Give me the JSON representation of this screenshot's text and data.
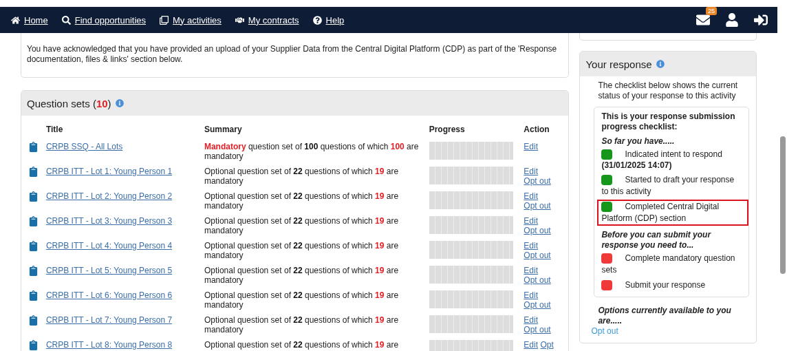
{
  "nav": {
    "items": [
      {
        "kind": "home",
        "label": "Home"
      },
      {
        "kind": "search",
        "label": "Find opportunities"
      },
      {
        "kind": "activities",
        "label": "My activities"
      },
      {
        "kind": "contracts",
        "label": "My contracts"
      },
      {
        "kind": "help",
        "label": "Help"
      }
    ],
    "mail_badge": "25"
  },
  "upload_notice": {
    "text": "You have acknowledged that you have provided an upload of your Supplier Data from the Central Digital Platform (CDP) as part of the 'Response documentation, files & links' section below."
  },
  "question_sets": {
    "title": "Question sets (**10**)",
    "columns": [
      "Title",
      "Summary",
      "Progress",
      "Action"
    ],
    "rows": [
      {
        "title": "CRPB SSQ - All Lots",
        "summary": [
          {
            "text": "Mandatory",
            "kind": "alert"
          },
          {
            "text": " question set of ",
            "kind": "plain"
          },
          {
            "text": "100",
            "kind": "bold"
          },
          {
            "text": " questions of which ",
            "kind": "plain"
          },
          {
            "text": "100",
            "kind": "alert"
          },
          {
            "text": " are mandatory",
            "kind": "plain"
          }
        ],
        "level": 0,
        "actions": [
          "Edit"
        ]
      },
      {
        "title": "CRPB ITT - Lot 1: Young Person 1",
        "summary": [
          {
            "text": "Optional question set of ",
            "kind": "plain"
          },
          {
            "text": "22",
            "kind": "bold"
          },
          {
            "text": " questions of which ",
            "kind": "plain"
          },
          {
            "text": "19",
            "kind": "alert"
          },
          {
            "text": " are mandatory",
            "kind": "plain"
          }
        ],
        "level": 0,
        "actions": [
          "Edit",
          "Opt out"
        ]
      },
      {
        "title": "CRPB ITT - Lot 2: Young Person 2",
        "summary": [
          {
            "text": "Optional question set of ",
            "kind": "plain"
          },
          {
            "text": "22",
            "kind": "bold"
          },
          {
            "text": " questions of which ",
            "kind": "plain"
          },
          {
            "text": "19",
            "kind": "alert"
          },
          {
            "text": " are mandatory",
            "kind": "plain"
          }
        ],
        "level": 0,
        "actions": [
          "Edit",
          "Opt out"
        ]
      },
      {
        "title": "CRPB ITT - Lot 3: Young Person 3",
        "summary": [
          {
            "text": "Optional question set of ",
            "kind": "plain"
          },
          {
            "text": "22",
            "kind": "bold"
          },
          {
            "text": " questions of which ",
            "kind": "plain"
          },
          {
            "text": "19",
            "kind": "alert"
          },
          {
            "text": " are mandatory",
            "kind": "plain"
          }
        ],
        "level": 0,
        "actions": [
          "Edit",
          "Opt out"
        ]
      },
      {
        "title": "CRPB ITT - Lot 4: Young Person 4",
        "summary": [
          {
            "text": "Optional question set of ",
            "kind": "plain"
          },
          {
            "text": "22",
            "kind": "bold"
          },
          {
            "text": " questions of which ",
            "kind": "plain"
          },
          {
            "text": "19",
            "kind": "alert"
          },
          {
            "text": " are mandatory",
            "kind": "plain"
          }
        ],
        "level": 0,
        "actions": [
          "Edit",
          "Opt out"
        ]
      },
      {
        "title": "CRPB ITT - Lot 5: Young Person 5",
        "summary": [
          {
            "text": "Optional question set of ",
            "kind": "plain"
          },
          {
            "text": "22",
            "kind": "bold"
          },
          {
            "text": " questions of which ",
            "kind": "plain"
          },
          {
            "text": "19",
            "kind": "alert"
          },
          {
            "text": " are mandatory",
            "kind": "plain"
          }
        ],
        "level": 0,
        "actions": [
          "Edit",
          "Opt out"
        ]
      },
      {
        "title": "CRPB ITT - Lot 6: Young Person 6",
        "summary": [
          {
            "text": "Optional question set of ",
            "kind": "plain"
          },
          {
            "text": "22",
            "kind": "bold"
          },
          {
            "text": " questions of which ",
            "kind": "plain"
          },
          {
            "text": "19",
            "kind": "alert"
          },
          {
            "text": " are mandatory",
            "kind": "plain"
          }
        ],
        "level": 0,
        "actions": [
          "Edit",
          "Opt out"
        ]
      },
      {
        "title": "CRPB ITT - Lot 7: Young Person 7",
        "summary": [
          {
            "text": "Optional question set of ",
            "kind": "plain"
          },
          {
            "text": "22",
            "kind": "bold"
          },
          {
            "text": " questions of which ",
            "kind": "plain"
          },
          {
            "text": "19",
            "kind": "alert"
          },
          {
            "text": " are mandatory",
            "kind": "plain"
          }
        ],
        "level": 0,
        "actions": [
          "Edit",
          "Opt out"
        ]
      },
      {
        "title": "CRPB ITT - Lot 8: Young Person 8",
        "summary": [
          {
            "text": "Optional question set of ",
            "kind": "plain"
          },
          {
            "text": "22",
            "kind": "bold"
          },
          {
            "text": " questions of which ",
            "kind": "plain"
          },
          {
            "text": "19",
            "kind": "alert"
          },
          {
            "text": " are",
            "kind": "plain"
          }
        ],
        "level": 0,
        "actions": [
          "Edit",
          "Opt"
        ]
      }
    ]
  },
  "your_response": {
    "title": "Your response",
    "intro": "The checklist below shows the current status of your response to this activity",
    "checklist_title": "This is your response submission progress checklist:",
    "groups": [
      {
        "heading": "So far you have.....",
        "items": [
          {
            "text": "Indicated intent to respond",
            "date": "(31/01/2025 14:07)",
            "done": true,
            "highlighted": false
          },
          {
            "text": "Started to draft your response to this activity",
            "done": true,
            "highlighted": false
          },
          {
            "text": "Completed Central Digital Platform (CDP) section",
            "done": true,
            "highlighted": true
          }
        ]
      },
      {
        "heading": "Before you can submit your response you need to...",
        "items": [
          {
            "text": "Complete mandatory question sets",
            "done": false,
            "highlighted": false
          },
          {
            "text": "Submit your response",
            "done": false,
            "highlighted": false
          }
        ]
      }
    ],
    "options_heading": "Options currently available to you are.....",
    "options": [
      "Opt out"
    ]
  }
}
